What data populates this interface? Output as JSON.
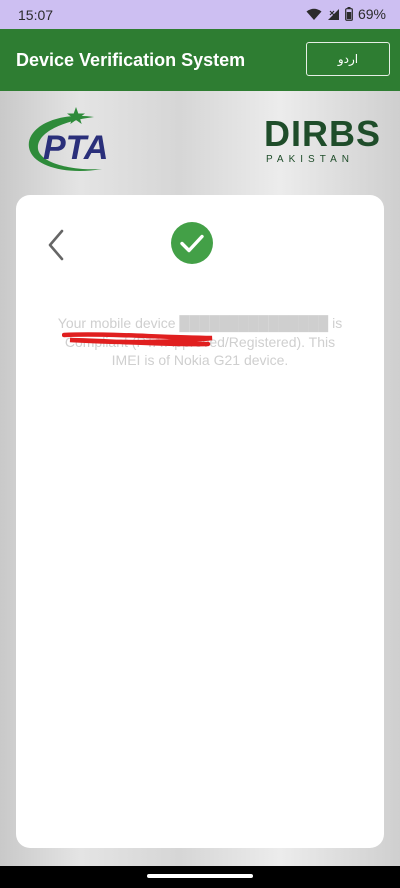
{
  "status_bar": {
    "time": "15:07",
    "battery": "69%",
    "icons": [
      "wifi-icon",
      "signal-icon",
      "battery-icon"
    ]
  },
  "app_bar": {
    "title": "Device Verification System",
    "language_button": "اردو"
  },
  "logos": {
    "pta": "PTA",
    "dirbs": "DIRBS",
    "dirbs_sub": "PAKISTAN"
  },
  "card": {
    "status_icon": "check-circle-icon",
    "message": "Your mobile device ███████████████ is Compliant (PTA Approved/Registered). This IMEI is of Nokia G21 device."
  },
  "colors": {
    "status_bar": "#cdbff2",
    "app_bar": "#2e7d32",
    "success": "#43a047",
    "redaction": "#e01f1f"
  }
}
